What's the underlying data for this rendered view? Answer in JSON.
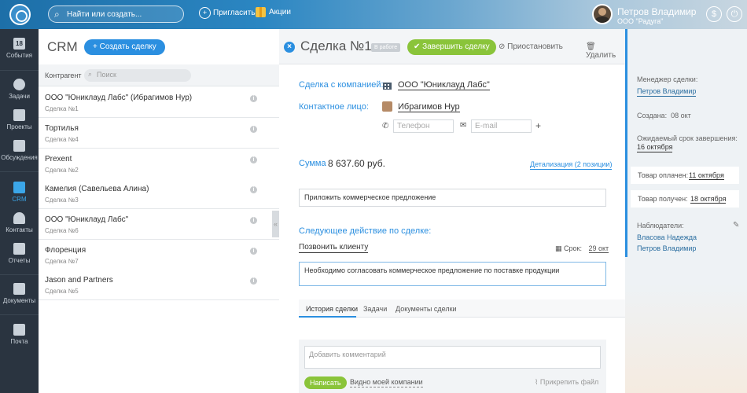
{
  "topbar": {
    "search_placeholder": "Найти или создать...",
    "invite_label": "Пригласить",
    "promo_label": "Акции",
    "user_name": "Петров Владимир",
    "user_company": "ООО \"Радуга\"",
    "dollar_glyph": "$",
    "power_glyph": "⏻"
  },
  "nav": {
    "items": [
      {
        "label": "События",
        "badge": "18"
      },
      {
        "label": "Задачи"
      },
      {
        "label": "Проекты"
      },
      {
        "label": "Обсуждения"
      },
      {
        "label": "CRM"
      },
      {
        "label": "Контакты"
      },
      {
        "label": "Отчеты"
      },
      {
        "label": "Документы"
      },
      {
        "label": "Почта"
      }
    ]
  },
  "list": {
    "title": "CRM",
    "create_button": "+ Создать сделку",
    "filter_label": "Контрагент",
    "filter_placeholder": "Поиск",
    "rows": [
      {
        "title": "ООО \"Юниклауд Лабс\" (Ибрагимов Нур)",
        "subtitle": "Сделка №1"
      },
      {
        "title": "Тортилья",
        "subtitle": "Сделка №4"
      },
      {
        "title": "Prexent",
        "subtitle": "Сделка №2"
      },
      {
        "title": "Камелия (Савельева Алина)",
        "subtitle": "Сделка №3"
      },
      {
        "title": "ООО \"Юниклауд Лабс\"",
        "subtitle": "Сделка №6"
      },
      {
        "title": "Флоренция",
        "subtitle": "Сделка №7"
      },
      {
        "title": "Jason and Partners",
        "subtitle": "Сделка №5"
      }
    ],
    "collapse_glyph": "«"
  },
  "deal": {
    "title": "Сделка №1",
    "status_badge": "В работе",
    "finish_button": "✔ Завершить сделку",
    "pause_button": "⊘ Приостановить",
    "delete_button": "🗑 Удалить",
    "company_label": "Сделка с компанией:",
    "company_value": "ООО \"Юниклауд Лабс\"",
    "contact_label": "Контактное лицо:",
    "contact_value": "Ибрагимов Нур",
    "phone_placeholder": "Телефон",
    "email_placeholder": "E-mail",
    "plus": "+",
    "sum_label": "Сумма",
    "sum_value": "8 637.60 руб.",
    "detail_link": "Детализация (2 позиции)",
    "note": "Приложить коммерческое предложение",
    "next_action_label": "Следующее действие по сделке:",
    "next_action_value": "Позвонить клиенту",
    "due_label": "Срок:",
    "due_value": "29 окт",
    "next_action_note": "Необходимо согласовать коммерческое предложение по поставке продукции",
    "tabs": [
      "История сделки",
      "Задачи",
      "Документы сделки"
    ],
    "comment_placeholder": "Добавить комментарий",
    "write_button": "Написать",
    "visibility_label": "Видно моей компании",
    "attach_label": "Прикрепить файл"
  },
  "side": {
    "manager_label": "Менеджер сделки:",
    "manager_value": "Петров Владимир",
    "created_label": "Создана:",
    "created_value": "08 окт",
    "expected_label": "Ожидаемый срок завершения:",
    "expected_value": "16 октября",
    "paid_label": "Товар оплачен:",
    "paid_value": "11 октября",
    "received_label": "Товар получен:",
    "received_value": "18 октября",
    "watchers_label": "Наблюдатели:",
    "watchers": [
      "Власова Надежда",
      "Петров Владимир"
    ],
    "pencil_glyph": "✎"
  }
}
